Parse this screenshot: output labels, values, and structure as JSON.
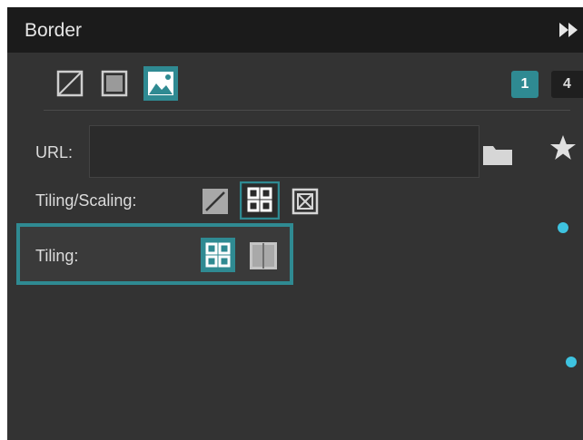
{
  "panel": {
    "title": "Border",
    "collapse_icon": "double-chevron-right-icon"
  },
  "type_tabs": [
    {
      "icon": "no-image-icon",
      "selected": false
    },
    {
      "icon": "solid-fill-icon",
      "selected": false
    },
    {
      "icon": "image-icon",
      "selected": true
    }
  ],
  "page_buttons": [
    {
      "label": "1",
      "active": true
    },
    {
      "label": "4",
      "active": false
    }
  ],
  "url": {
    "label": "URL:",
    "value": "",
    "browse_icon": "folder-icon",
    "favorite_icon": "star-icon"
  },
  "tiling_scaling": {
    "label": "Tiling/Scaling:",
    "options": [
      {
        "icon": "stretch-icon",
        "selected": false
      },
      {
        "icon": "tile-grid-icon",
        "selected": true
      },
      {
        "icon": "fit-cross-icon",
        "selected": false
      }
    ]
  },
  "tiling": {
    "label": "Tiling:",
    "options": [
      {
        "icon": "tile-grid-icon",
        "selected": true
      },
      {
        "icon": "tile-columns-icon",
        "selected": false
      }
    ]
  },
  "colors": {
    "accent": "#2f8a92",
    "dot": "#3ec3e0",
    "panel_bg": "#333333",
    "header_bg": "#1b1b1b"
  }
}
